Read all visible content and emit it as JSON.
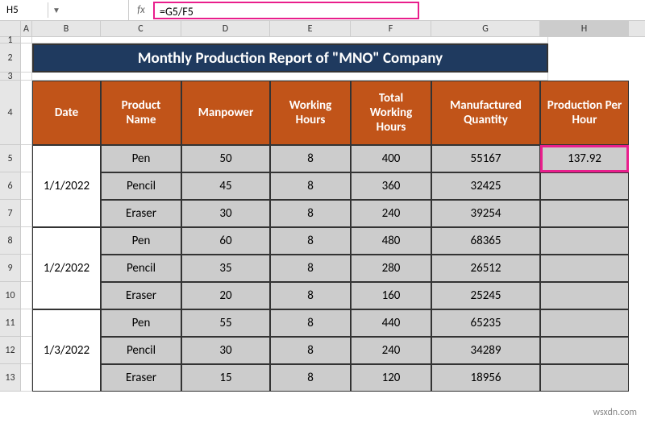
{
  "nameBox": "H5",
  "formula": "=G5/F5",
  "columns": [
    "A",
    "B",
    "C",
    "D",
    "E",
    "F",
    "G",
    "H"
  ],
  "title": "Monthly Production Report of \"MNO\" Company",
  "headers": {
    "date": "Date",
    "product": "Product Name",
    "manpower": "Manpower",
    "workHours": "Working Hours",
    "totalWorkHours": "Total Working Hours",
    "mfgQty": "Manufactured Quantity",
    "prodPerHour": "Production Per Hour"
  },
  "groups": [
    {
      "date": "1/1/2022",
      "rows": [
        {
          "product": "Pen",
          "manpower": "50",
          "wh": "8",
          "twh": "400",
          "qty": "55167",
          "pph": "137.92"
        },
        {
          "product": "Pencil",
          "manpower": "45",
          "wh": "8",
          "twh": "360",
          "qty": "32425",
          "pph": ""
        },
        {
          "product": "Eraser",
          "manpower": "30",
          "wh": "8",
          "twh": "240",
          "qty": "39254",
          "pph": ""
        }
      ]
    },
    {
      "date": "1/2/2022",
      "rows": [
        {
          "product": "Pen",
          "manpower": "60",
          "wh": "8",
          "twh": "480",
          "qty": "68365",
          "pph": ""
        },
        {
          "product": "Pencil",
          "manpower": "35",
          "wh": "8",
          "twh": "280",
          "qty": "26512",
          "pph": ""
        },
        {
          "product": "Eraser",
          "manpower": "20",
          "wh": "8",
          "twh": "160",
          "qty": "25245",
          "pph": ""
        }
      ]
    },
    {
      "date": "1/3/2022",
      "rows": [
        {
          "product": "Pen",
          "manpower": "55",
          "wh": "8",
          "twh": "440",
          "qty": "65235",
          "pph": ""
        },
        {
          "product": "Pencil",
          "manpower": "30",
          "wh": "8",
          "twh": "240",
          "qty": "34289",
          "pph": ""
        },
        {
          "product": "Eraser",
          "manpower": "15",
          "wh": "8",
          "twh": "120",
          "qty": "18956",
          "pph": ""
        }
      ]
    }
  ],
  "rowNums": [
    "1",
    "2",
    "3",
    "4",
    "5",
    "6",
    "7",
    "8",
    "9",
    "10",
    "11",
    "12",
    "13"
  ],
  "watermark": "wsxdn.com"
}
